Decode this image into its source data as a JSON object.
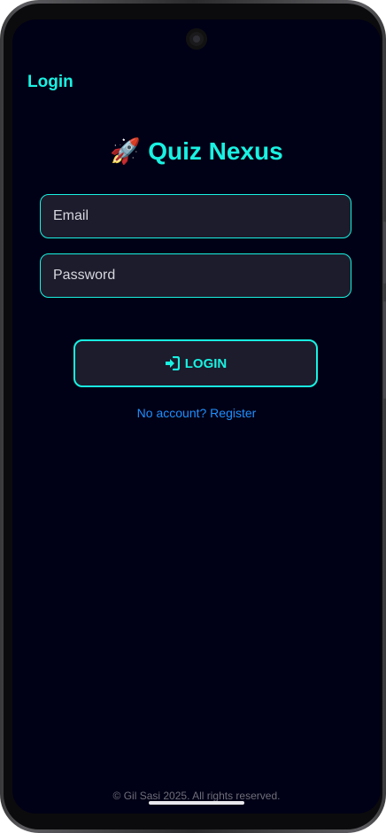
{
  "app_bar": {
    "title": "Login"
  },
  "header": {
    "title": "Quiz Nexus",
    "emoji": "🚀"
  },
  "form": {
    "email": {
      "placeholder": "Email",
      "value": ""
    },
    "password": {
      "placeholder": "Password",
      "value": ""
    }
  },
  "login_button": {
    "label": "LOGIN",
    "icon": "login-icon"
  },
  "register_link": {
    "label": "No account? Register"
  },
  "footer": {
    "text": "© Gil Sasi 2025. All rights reserved."
  },
  "colors": {
    "accent": "#19f2e2",
    "background": "#000016",
    "field_fill": "#1c1c2c",
    "link": "#1e90ff"
  }
}
